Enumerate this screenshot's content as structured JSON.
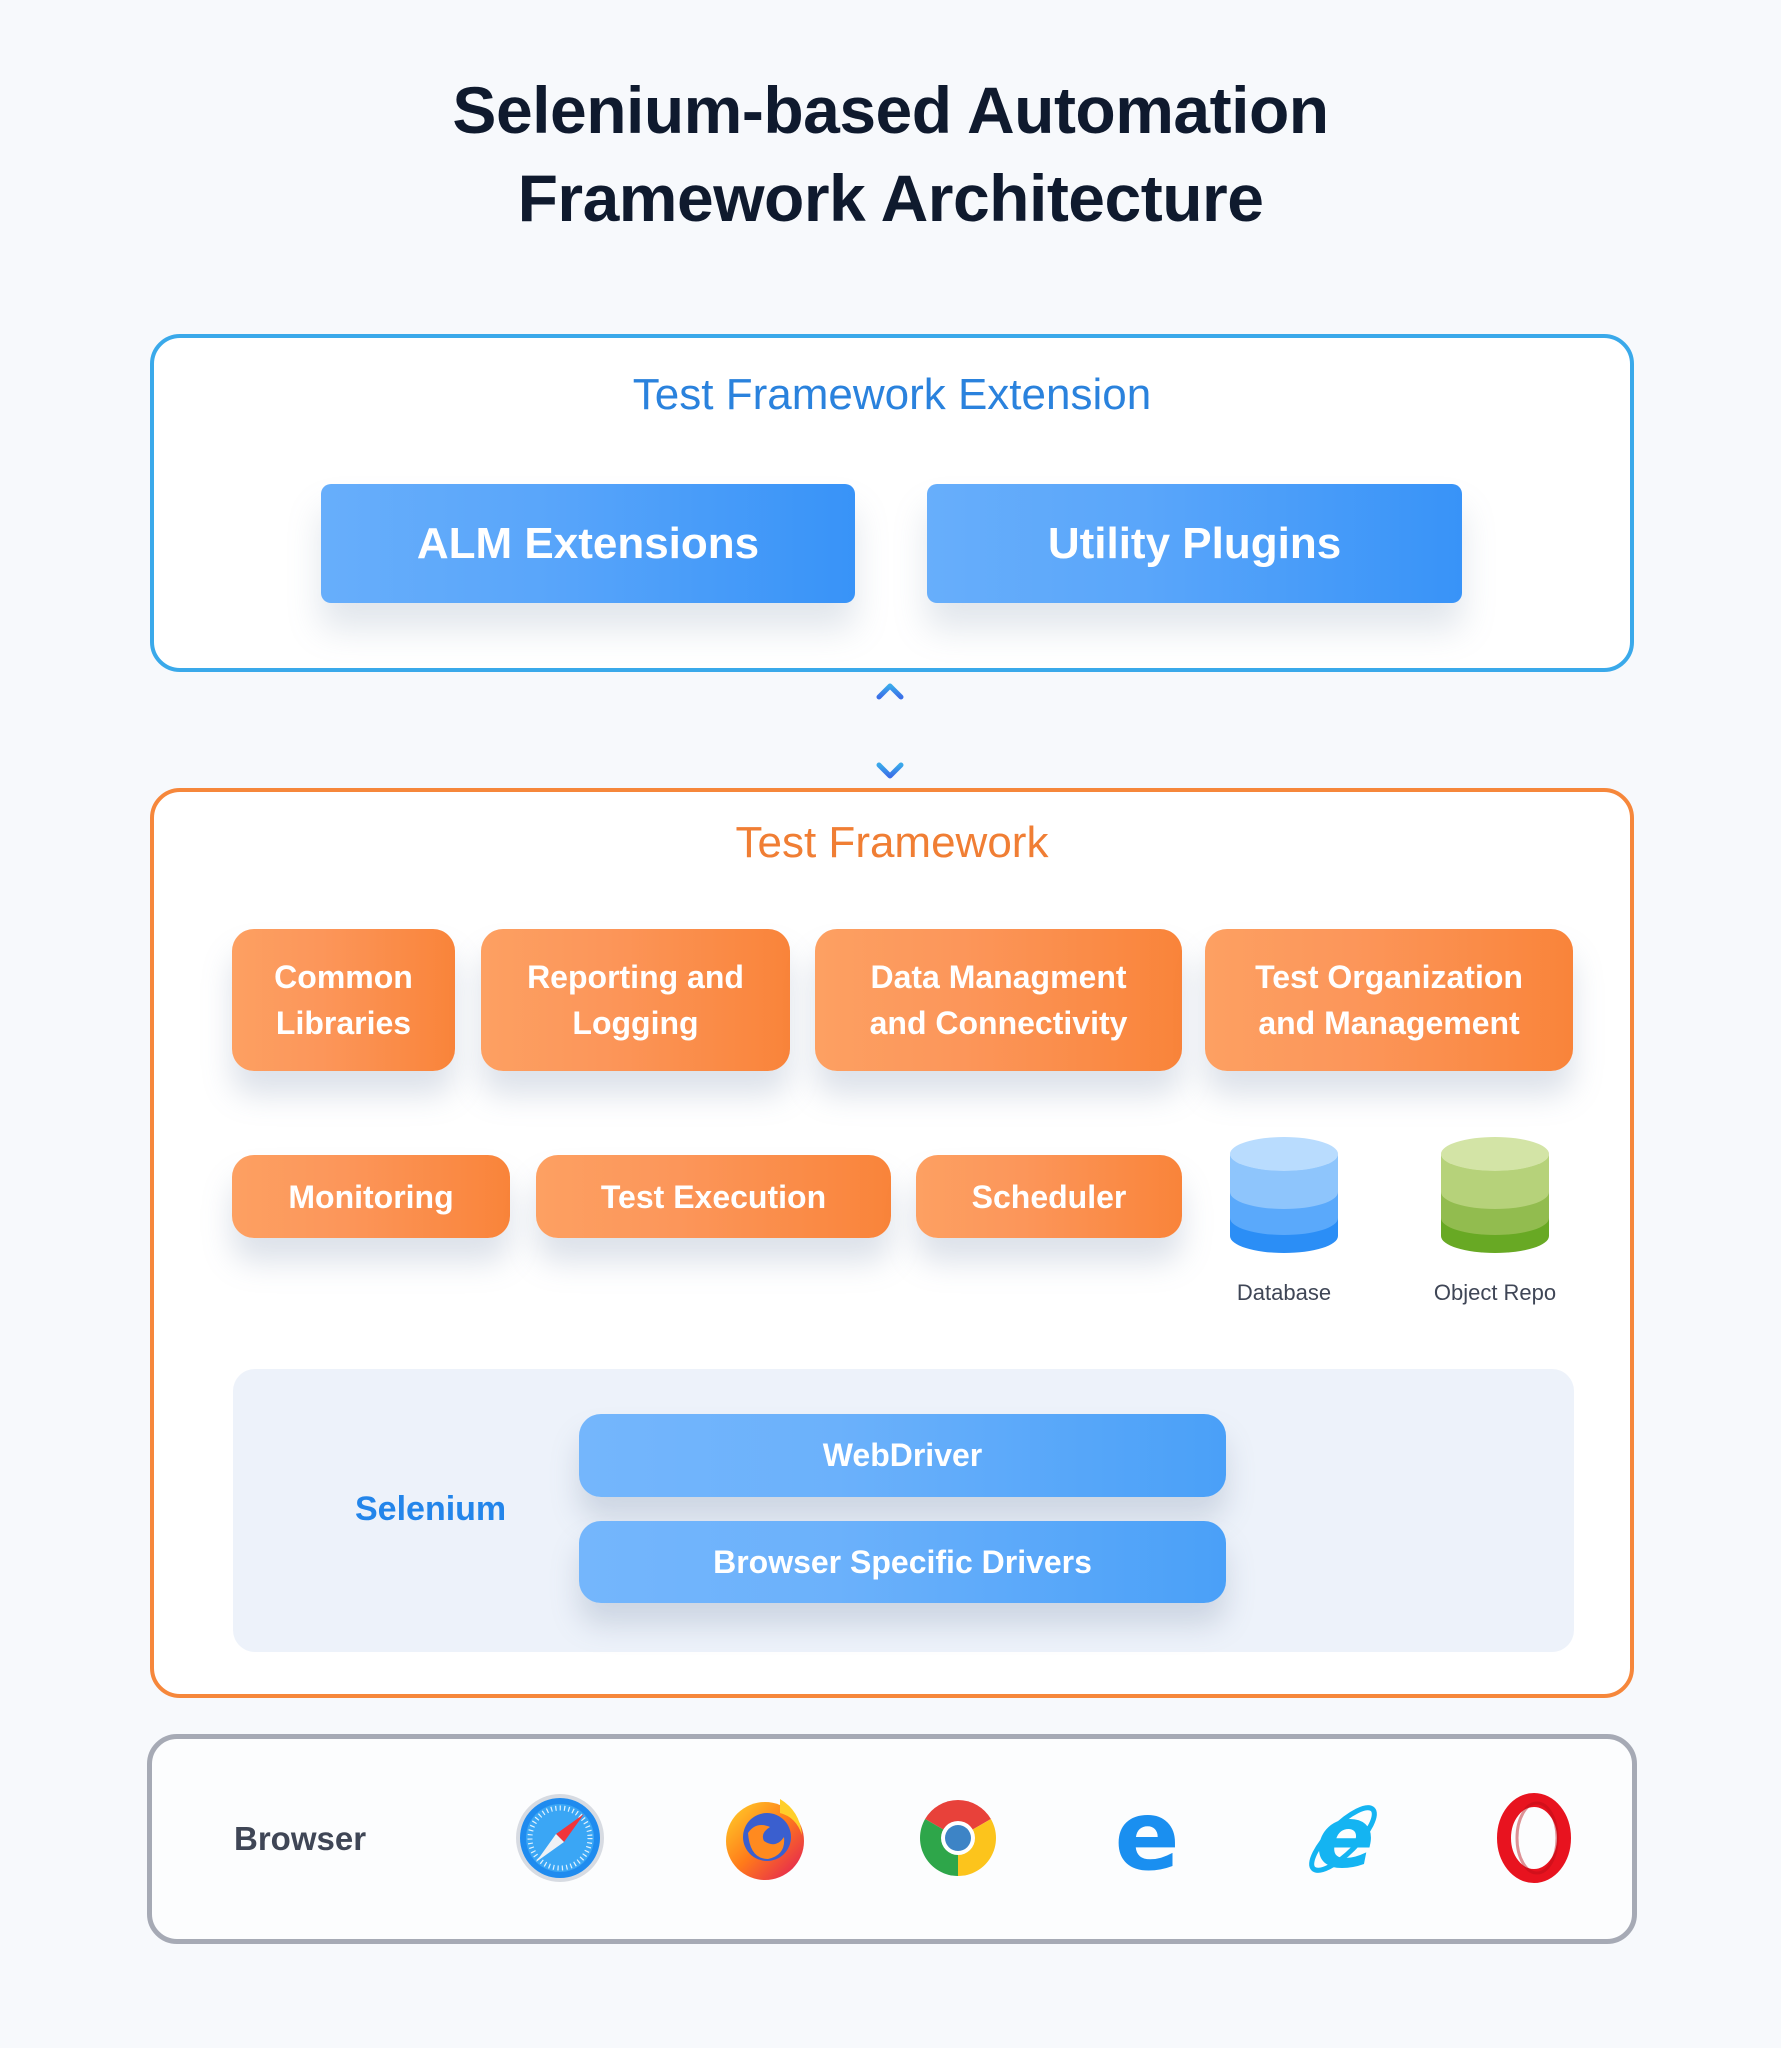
{
  "title": {
    "line1": "Selenium-based Automation",
    "line2": "Framework Architecture"
  },
  "extension_layer": {
    "title": "Test Framework Extension",
    "border_color": "#3aa9ea",
    "items": [
      "ALM Extensions",
      "Utility Plugins"
    ]
  },
  "connector": {
    "icon": "double-arrow-vertical-icon",
    "direction": "bidirectional"
  },
  "framework_layer": {
    "title": "Test Framework",
    "border_color": "#f6873b",
    "row1": [
      {
        "line1": "Common",
        "line2": "Libraries"
      },
      {
        "line1": "Reporting and",
        "line2": "Logging"
      },
      {
        "line1": "Data Managment",
        "line2": "and Connectivity"
      },
      {
        "line1": "Test Organization",
        "line2": "and Management"
      }
    ],
    "row2": [
      "Monitoring",
      "Test Execution",
      "Scheduler"
    ],
    "stores": [
      {
        "label": "Database",
        "icon": "database-icon",
        "color": "#2b8ef6"
      },
      {
        "label": "Object Repo",
        "icon": "object-repo-icon",
        "color": "#6aaa24"
      }
    ],
    "selenium": {
      "label": "Selenium",
      "components": [
        "WebDriver",
        "Browser Specific Drivers"
      ]
    }
  },
  "browser_layer": {
    "label": "Browser",
    "browsers": [
      {
        "name": "Safari",
        "icon": "safari-icon"
      },
      {
        "name": "Firefox",
        "icon": "firefox-icon"
      },
      {
        "name": "Chrome",
        "icon": "chrome-icon"
      },
      {
        "name": "Edge",
        "icon": "edge-icon"
      },
      {
        "name": "Internet Explorer",
        "icon": "internet-explorer-icon"
      },
      {
        "name": "Opera",
        "icon": "opera-icon"
      }
    ]
  }
}
